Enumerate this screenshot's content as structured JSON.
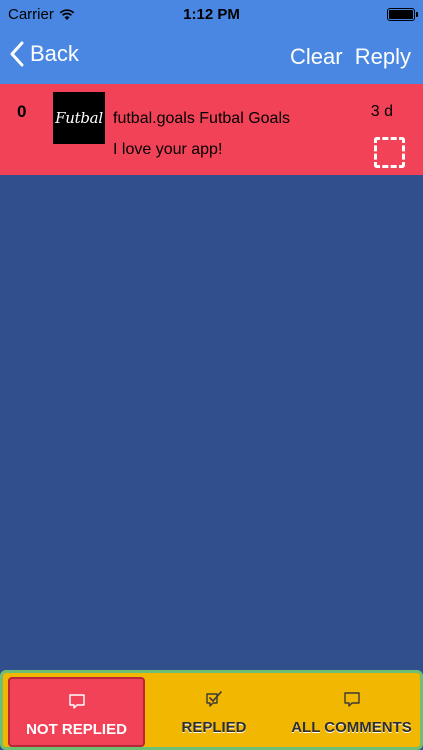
{
  "status_bar": {
    "carrier": "Carrier",
    "time": "1:12 PM"
  },
  "nav": {
    "back_label": "Back",
    "clear_label": "Clear",
    "reply_label": "Reply"
  },
  "comment": {
    "count": "0",
    "avatar_text": "Futbal",
    "user": "futbal.goals Futbal Goals",
    "text": "I love your app!",
    "age": "3 d"
  },
  "tabs": {
    "not_replied": "NOT REPLIED",
    "replied": "REPLIED",
    "all_comments": "ALL COMMENTS"
  },
  "colors": {
    "nav": "#4a87e2",
    "background": "#304f8c",
    "row_unreplied": "#f24257",
    "tab_bar": "#f2b700",
    "tab_border": "#6fbf73"
  }
}
